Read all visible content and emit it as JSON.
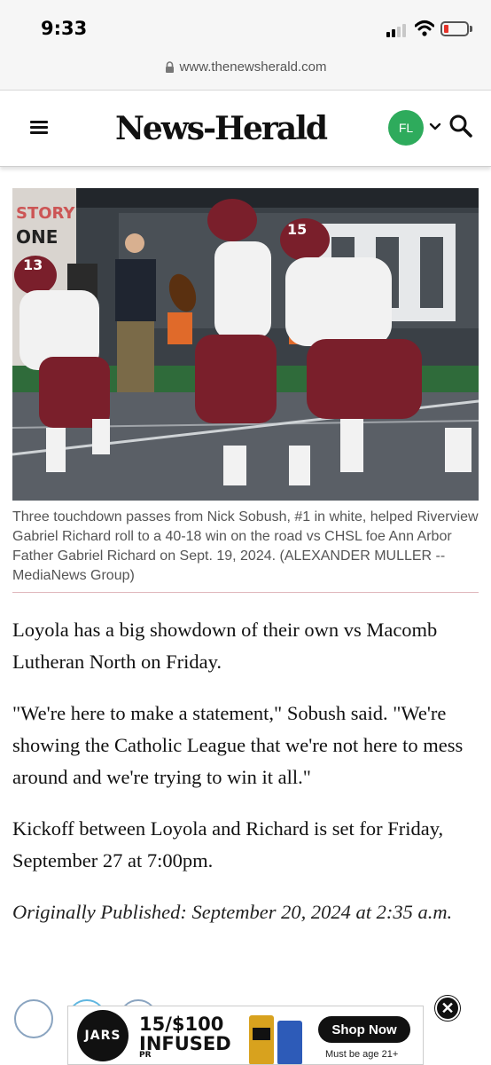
{
  "status_bar": {
    "time": "9:33"
  },
  "browser": {
    "url": "www.thenewsherald.com"
  },
  "header": {
    "logo": "News-Herald",
    "user_initials": "FL"
  },
  "photo": {
    "caption": "Three touchdown passes from Nick Sobush, #1 in white, helped Riverview Gabriel Richard roll to a 40-18 win on the road vs CHSL foe Ann Arbor Father Gabriel Richard on Sept. 19, 2024. (ALEXANDER MULLER -- MediaNews Group)",
    "sign_left": "STORY",
    "sign_left_2": "ONE",
    "jersey_numbers": [
      "13",
      "15"
    ]
  },
  "article": {
    "paragraphs": [
      "Loyola has a big showdown of their own vs Macomb Lutheran North on Friday.",
      "\"We're here to make a statement,\" Sobush said. \"We're showing the Catholic League that we're not here to mess around and we're trying to win it all.\"",
      "Kickoff between Loyola and Richard is set for Friday, September 27 at 7:00pm."
    ],
    "published": "Originally Published: September 20, 2024 at 2:35 a.m."
  },
  "ad": {
    "brand": "JARS",
    "line1": "15/$100",
    "line2": "INFUSED",
    "sub": "PR",
    "cta": "Shop Now",
    "note": "Must be age 21+"
  },
  "colors": {
    "avatar": "#2eab5c",
    "jersey": "#7a1f2b"
  }
}
